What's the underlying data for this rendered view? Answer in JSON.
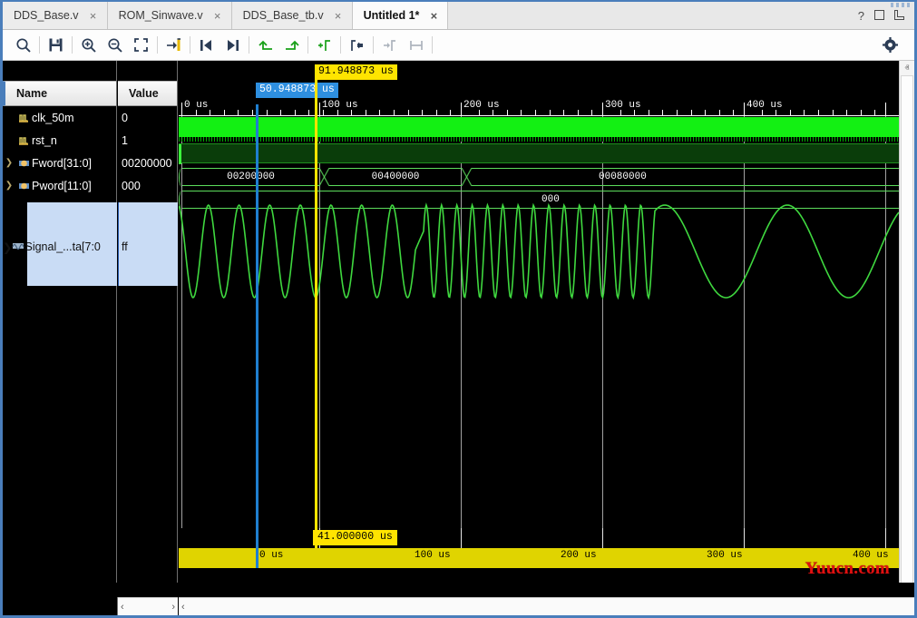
{
  "window": {
    "help_label": "?",
    "restore_label": "restore",
    "float_label": "float"
  },
  "tabs": [
    {
      "label": "DDS_Base.v",
      "close": "×",
      "active": false
    },
    {
      "label": "ROM_Sinwave.v",
      "close": "×",
      "active": false
    },
    {
      "label": "DDS_Base_tb.v",
      "close": "×",
      "active": false
    },
    {
      "label": "Untitled 1*",
      "close": "×",
      "active": true
    }
  ],
  "toolbar": {
    "buttons": [
      {
        "name": "search-icon",
        "title": "Search"
      },
      {
        "name": "save-icon",
        "title": "Save"
      },
      {
        "name": "zoom-in-icon",
        "title": "Zoom In"
      },
      {
        "name": "zoom-out-icon",
        "title": "Zoom Out"
      },
      {
        "name": "zoom-fit-icon",
        "title": "Zoom Fit"
      },
      {
        "name": "goto-cursor-icon",
        "title": "Go To Cursor"
      },
      {
        "name": "prev-transition-icon",
        "title": "Previous Transition"
      },
      {
        "name": "next-transition-icon",
        "title": "Next Transition"
      },
      {
        "name": "prev-edge-icon",
        "title": "Previous Edge"
      },
      {
        "name": "next-edge-icon",
        "title": "Next Edge"
      },
      {
        "name": "add-marker-icon",
        "title": "Add Marker"
      },
      {
        "name": "prev-marker-icon",
        "title": "Previous Marker"
      },
      {
        "name": "next-marker-icon",
        "title": "Next Marker"
      },
      {
        "name": "measure-icon",
        "title": "Measure"
      }
    ],
    "settings_label": "Settings"
  },
  "panel": {
    "name_header": "Name",
    "value_header": "Value",
    "signals": [
      {
        "name": "clk_50m",
        "value": "0",
        "icon": "clock-signal-icon",
        "expandable": false,
        "selected": false
      },
      {
        "name": "rst_n",
        "value": "1",
        "icon": "logic-signal-icon",
        "expandable": false,
        "selected": false
      },
      {
        "name": "Fword[31:0]",
        "value": "00200000",
        "icon": "bus-signal-icon",
        "expandable": true,
        "selected": false
      },
      {
        "name": "Pword[11:0]",
        "value": "000",
        "icon": "bus-signal-icon",
        "expandable": true,
        "selected": false
      },
      {
        "name": "Signal_...ta[7:0",
        "value": "ff",
        "icon": "analog-signal-icon",
        "expandable": true,
        "selected": true
      }
    ]
  },
  "waveform": {
    "time_unit": "us",
    "ruler_ticks": [
      {
        "label": "0 us",
        "time": 0
      },
      {
        "label": "100 us",
        "time": 100
      },
      {
        "label": "200 us",
        "time": 200
      },
      {
        "label": "300 us",
        "time": 300
      },
      {
        "label": "400 us",
        "time": 400
      }
    ],
    "cursors": [
      {
        "name": "secondary-cursor",
        "label": "50.948873 us",
        "time": 50.948873,
        "color": "#2e8fe0"
      },
      {
        "name": "primary-cursor",
        "label": "91.948873 us",
        "time": 91.948873,
        "color": "#ffe400"
      }
    ],
    "fword_segments": [
      {
        "value": "00200000",
        "start": 0,
        "end": 155
      },
      {
        "value": "00400000",
        "start": 160,
        "end": 311
      },
      {
        "value": "00080000",
        "start": 316,
        "end": 470
      }
    ],
    "pword_segments": [
      {
        "value": "000",
        "start": 0,
        "end": 470
      }
    ]
  },
  "overview": {
    "marker_label": "41.000000 us",
    "ticks": [
      {
        "label": "0 us",
        "time": 0
      },
      {
        "label": "100 us",
        "time": 100
      },
      {
        "label": "200 us",
        "time": 200
      },
      {
        "label": "300 us",
        "time": 300
      },
      {
        "label": "400 us",
        "time": 400
      }
    ]
  },
  "watermark": {
    "text": "Yuucn.com"
  },
  "scrollbars": {
    "up_arrow": "ⱏ",
    "down_arrow": "ⱟ",
    "left_arrow": "‹",
    "right_arrow": "›"
  },
  "colors": {
    "accent": "#4a7ebb",
    "signal_green": "#13f013",
    "bus_green": "#5cdd5c",
    "cursor_blue": "#2e8fe0",
    "cursor_yellow": "#ffe400",
    "overview_yellow": "#e0d400",
    "watermark_red": "#e01010"
  }
}
